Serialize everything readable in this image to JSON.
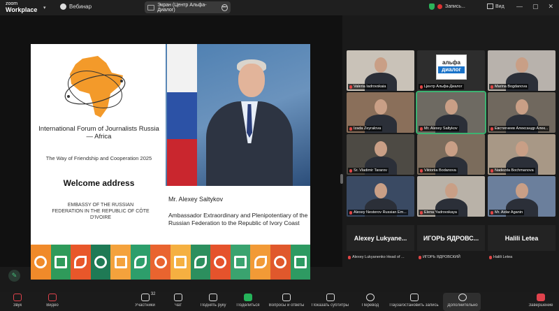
{
  "topbar": {
    "brand_line1": "zoom",
    "brand_line2": "Workplace",
    "webinar_label": "Вебинар",
    "share_label": "Экран (Центр Альфа-Диалог)",
    "recording_label": "Запись...",
    "view_label": "Вид"
  },
  "slide": {
    "forum_title": "International Forum of Journalists Russia — Africa",
    "forum_subtitle": "The Way of Friendship and Cooperation 2025",
    "welcome": "Welcome address",
    "embassy": "EMBASSY OF THE RUSSIAN FEDERATION IN THE REPUBLIC OF CÔTE D'IVOIRE",
    "speaker_name": "Mr. Alexey Saltykov",
    "speaker_title": "Ambassador Extraordinary and Plenipotentiary of the Russian Federation to the Republic of Ivory Coast",
    "band_colors": [
      "#f08a2a",
      "#2f9a5a",
      "#e8572a",
      "#1f7a55",
      "#f4a23c",
      "#2d9e6b",
      "#e9642f",
      "#f5b041",
      "#2c8f5e",
      "#e5532c",
      "#3aa36f",
      "#f29a36",
      "#e0582c",
      "#2e9a62"
    ]
  },
  "gallery": {
    "alfa_logo_top": "альфа",
    "alfa_logo_bottom": "диалог",
    "participants": [
      {
        "name": "Valeria Iadrovskaia"
      },
      {
        "name": "Центр Альфа-Диалог"
      },
      {
        "name": "Marina Bogdanova"
      },
      {
        "name": "Izada Zeyralova"
      },
      {
        "name": "Mr. Alexey Saltykov"
      },
      {
        "name": "Евстигнеев Александр Алек..."
      },
      {
        "name": "Sr. Vladimir Tararov"
      },
      {
        "name": "Viktoriia Bodanova"
      },
      {
        "name": "Nadezda Bochmanova"
      },
      {
        "name": "Alexey Nesterov Russian Em..."
      },
      {
        "name": "Elena Yadrovskaya"
      },
      {
        "name": "Mr. Aidar Aganin"
      }
    ],
    "name_tiles": [
      {
        "big": "Alexey  Lukyane...",
        "small": "Alexey Lukyanenko Head of ..."
      },
      {
        "big": "ИГОРЬ  ЯДРОВС...",
        "small": "ИГОРЬ ЯДРОВСКИЙ"
      },
      {
        "big": "Halili Letea",
        "small": "Halili Letea"
      }
    ]
  },
  "toolbar": {
    "participants_count": "32",
    "items": [
      "Звук",
      "Видео",
      "Участники",
      "Чат",
      "Поднять руку",
      "Поделиться",
      "Вопросы и ответы",
      "Показать субтитры",
      "Перевод",
      "Пауза/остановить запись",
      "Дополнительно",
      "Завершение"
    ]
  },
  "colors": {
    "accent_green": "#25b35a",
    "alert_red": "#e0424c"
  }
}
